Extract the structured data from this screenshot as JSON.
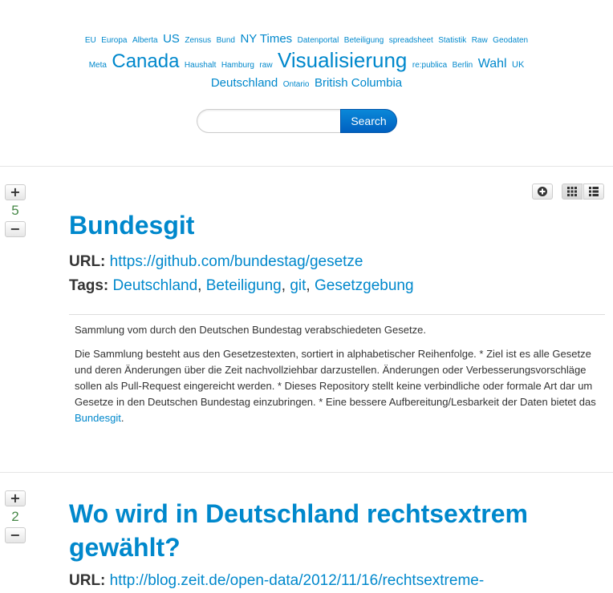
{
  "tagcloud": {
    "row1": [
      {
        "label": "EU",
        "size": "t10"
      },
      {
        "label": "Europa",
        "size": "t10"
      },
      {
        "label": "Alberta",
        "size": "t10"
      },
      {
        "label": "US",
        "size": "t15"
      },
      {
        "label": "Zensus",
        "size": "t10"
      },
      {
        "label": "Bund",
        "size": "t10"
      },
      {
        "label": "NY Times",
        "size": "t15"
      },
      {
        "label": "Datenportal",
        "size": "t10"
      },
      {
        "label": "Beteiligung",
        "size": "t10"
      },
      {
        "label": "spreadsheet",
        "size": "t10"
      },
      {
        "label": "Statistik",
        "size": "t10"
      },
      {
        "label": "Raw",
        "size": "t10"
      },
      {
        "label": "Geodaten",
        "size": "t10"
      }
    ],
    "row2": [
      {
        "label": "Meta",
        "size": "t10"
      },
      {
        "label": "Canada",
        "size": "t24"
      },
      {
        "label": "Haushalt",
        "size": "t10"
      },
      {
        "label": "Hamburg",
        "size": "t10"
      },
      {
        "label": "raw",
        "size": "t10"
      },
      {
        "label": "Visualisierung",
        "size": "t26"
      },
      {
        "label": "re:publica",
        "size": "t10"
      },
      {
        "label": "Berlin",
        "size": "t10"
      },
      {
        "label": "Wahl",
        "size": "t16"
      },
      {
        "label": "UK",
        "size": "t11"
      }
    ],
    "row3": [
      {
        "label": "Deutschland",
        "size": "t15"
      },
      {
        "label": "Ontario",
        "size": "t10"
      },
      {
        "label": "British Columbia",
        "size": "t15"
      }
    ]
  },
  "search": {
    "placeholder": "",
    "value": "",
    "button_label": "Search"
  },
  "toolbar": {
    "add_icon": "plus-circle-icon",
    "grid_icon": "grid-icon",
    "list_icon": "list-icon"
  },
  "entries": [
    {
      "vote_up": "+",
      "votes": "5",
      "vote_down": "−",
      "title": "Bundesgit",
      "url_label": "URL:",
      "url": "https://github.com/bundestag/gesetze",
      "tags_label": "Tags:",
      "tags": [
        "Deutschland",
        "Beteiligung",
        "git",
        "Gesetzgebung"
      ],
      "separator": ",",
      "desc_p1": "Sammlung vom durch den Deutschen Bundestag verabschiedeten Gesetze.",
      "desc_p2": "Die Sammlung besteht aus den Gesetzestexten, sortiert in alphabetischer Reihenfolge. * Ziel ist es alle Gesetze und deren Änderungen über die Zeit nachvollziehbar darzustellen. Änderungen oder Verbesserungsvorschläge sollen als Pull-Request eingereicht werden. * Dieses Repository stellt keine verbindliche oder formale Art dar um Gesetze in den Deutschen Bundestag einzubringen. * Eine bessere Aufbereitung/Lesbarkeit der Daten bietet das",
      "desc_link": "Bundesgit",
      "desc_end": "."
    },
    {
      "vote_up": "+",
      "votes": "2",
      "vote_down": "−",
      "title": "Wo wird in Deutschland rechtsextrem gewählt?",
      "url_label": "URL:",
      "url": "http://blog.zeit.de/open-data/2012/11/16/rechtsextreme-"
    }
  ],
  "colors": {
    "link": "#0088cc",
    "vote_count": "#468847",
    "text": "#333333"
  }
}
